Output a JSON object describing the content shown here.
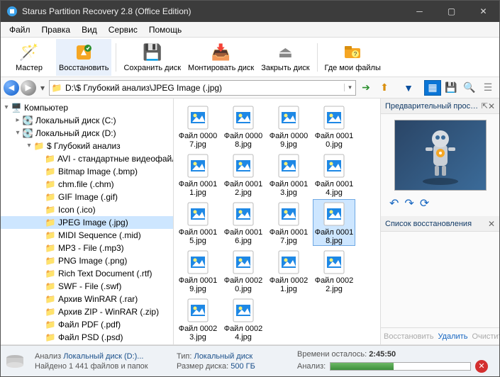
{
  "window": {
    "title": "Starus Partition Recovery 2.8 (Office Edition)"
  },
  "menu": {
    "file": "Файл",
    "edit": "Правка",
    "view": "Вид",
    "service": "Сервис",
    "help": "Помощь"
  },
  "toolbar": {
    "wizard": "Мастер",
    "recover": "Восстановить",
    "savedisk": "Сохранить диск",
    "mount": "Монтировать диск",
    "closedisk": "Закрыть диск",
    "wherefiles": "Где мои файлы"
  },
  "address": {
    "path": "D:\\$ Глубокий анализ\\JPEG Image (.jpg)"
  },
  "tree": {
    "computer": "Компьютер",
    "localC": "Локальный диск (C:)",
    "localD": "Локальный диск (D:)",
    "deep": "$ Глубокий анализ",
    "items": [
      "AVI - стандартные видеофайл",
      "Bitmap Image (.bmp)",
      "chm.file (.chm)",
      "GIF Image (.gif)",
      "Icon (.ico)",
      "JPEG Image (.jpg)",
      "MIDI Sequence (.mid)",
      "MP3 - File (.mp3)",
      "PNG Image (.png)",
      "Rich Text Document (.rtf)",
      "SWF - File (.swf)",
      "Архив WinRAR (.rar)",
      "Архив ZIP - WinRAR (.zip)",
      "Файл PDF (.pdf)",
      "Файл PSD (.psd)"
    ],
    "selected_index": 5
  },
  "files": {
    "generic_prefix": "Файл",
    "items": [
      "00007.jpg",
      "00008.jpg",
      "00009.jpg",
      "00010.jpg",
      "00011.jpg",
      "00012.jpg",
      "00013.jpg",
      "00014.jpg",
      "00015.jpg",
      "00016.jpg",
      "00017.jpg",
      "00018.jpg",
      "00019.jpg",
      "00020.jpg",
      "00021.jpg",
      "00022.jpg",
      "00023.jpg",
      "00024.jpg"
    ],
    "selected_index": 11
  },
  "preview": {
    "title": "Предварительный просмотр"
  },
  "recovery": {
    "title": "Список восстановления",
    "actions": {
      "recover": "Восстановить",
      "delete": "Удалить",
      "clear": "Очистить"
    }
  },
  "status": {
    "analysis_line1_label": "Анализ",
    "analysis_target": "Локальный диск (D:)...",
    "found_line_full": "Найдено 1 441 файлов и папок",
    "type_label": "Тип:",
    "type_value": "Локальный диск",
    "size_label": "Размер диска:",
    "size_value": "500 ГБ",
    "remain_label": "Времени осталось:",
    "remain_value": "2:45:50",
    "progress_label": "Анализ:"
  }
}
